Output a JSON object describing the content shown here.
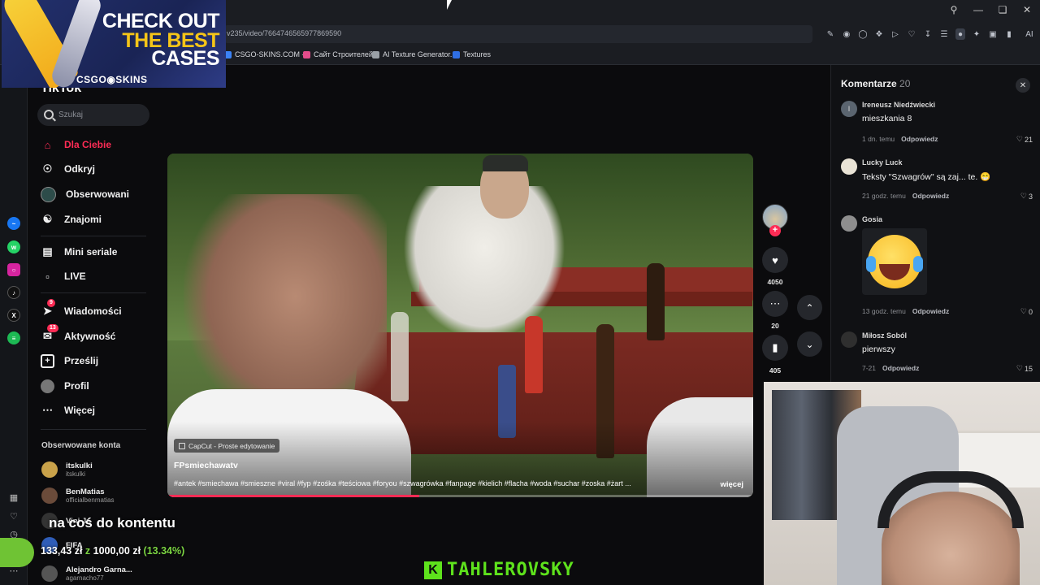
{
  "browser": {
    "url": "v235/video/7664746565977869590",
    "bookmarks": [
      {
        "label": "CSGO-SKINS.COM -...",
        "color": "#3b82f6"
      },
      {
        "label": "Сайт Строителей",
        "color": "#e24c8a"
      },
      {
        "label": "AI Texture Generator...",
        "color": "#9aa0a6"
      },
      {
        "label": "Textures",
        "color": "#2f6fe4"
      }
    ],
    "ai_button": "AI"
  },
  "ad": {
    "line1": "CHECK OUT",
    "line2": "THE BEST",
    "line3": "CASES",
    "logo": "CSGO◉SKINS"
  },
  "sidebar": {
    "logo": "TikTok",
    "search_placeholder": "Szukaj",
    "nav": [
      {
        "label": "Dla Ciebie",
        "icon": "home-icon",
        "active": true
      },
      {
        "label": "Odkryj",
        "icon": "compass-icon"
      },
      {
        "label": "Obserwowani",
        "icon": "following-avatar-icon"
      },
      {
        "label": "Znajomi",
        "icon": "friends-icon"
      },
      {
        "label": "Mini seriale",
        "icon": "series-icon"
      },
      {
        "label": "LIVE",
        "icon": "live-icon"
      },
      {
        "label": "Wiadomości",
        "icon": "messages-icon",
        "badge": "9"
      },
      {
        "label": "Aktywność",
        "icon": "activity-icon",
        "badge": "13"
      },
      {
        "label": "Prześlij",
        "icon": "upload-icon"
      },
      {
        "label": "Profil",
        "icon": "profile-icon"
      },
      {
        "label": "Więcej",
        "icon": "more-icon"
      }
    ],
    "followed_title": "Obserwowane konta",
    "accounts": [
      {
        "name": "itskulki",
        "handle": "itskulki",
        "color": "#c9a24a"
      },
      {
        "name": "BenMatias",
        "handle": "officialbenmatias",
        "color": "#6a4b3a"
      },
      {
        "name": "Vini Jr.",
        "handle": "",
        "color": "#333"
      },
      {
        "name": "FIFA",
        "handle": "",
        "color": "#2f5db8"
      },
      {
        "name": "Alejandro Garna...",
        "handle": "agarnacho77",
        "color": "#555"
      }
    ]
  },
  "video": {
    "capcut_label": "CapCut - Proste edytowanie",
    "author": "FPsmiechawatv",
    "tags": "#antek #smiechawa #smieszne #viral #fyp #zośka #teściowa #foryou #szwagrówka #fanpage #kielich #flacha #woda #suchar #zoska #żart ...",
    "more_label": "więcej",
    "progress": 0.43
  },
  "actions": {
    "likes": "4050",
    "comments": "20",
    "saves": "405"
  },
  "comments_panel": {
    "title": "Komentarze",
    "count": "20",
    "items": [
      {
        "name": "Ireneusz Niedźwiecki",
        "text": "mieszkania 8",
        "time": "1 dn. temu",
        "reply": "Odpowiedz",
        "likes": "21",
        "avatar_color": "#5b6570",
        "initial": "I"
      },
      {
        "name": "Lucky Luck",
        "text": "Teksty \"Szwagrów\" są zaj... te. 😁",
        "time": "21 godz. temu",
        "reply": "Odpowiedz",
        "likes": "3",
        "avatar_color": "#e9e3d6"
      },
      {
        "name": "Gosia",
        "text": "",
        "time": "13 godz. temu",
        "reply": "Odpowiedz",
        "likes": "0",
        "avatar_color": "#8e8e8e",
        "sticker": "laughing-crying-emoji"
      },
      {
        "name": "Miłosz Soból",
        "text": "pierwszy",
        "time": "7-21",
        "reply": "Odpowiedz",
        "likes": "15",
        "avatar_color": "#2f2f2f"
      }
    ]
  },
  "overlay": {
    "goal_text": "na coś do kontentu",
    "goal_current": "133,43 zł",
    "goal_of": "z",
    "goal_target": "1000,00 zł",
    "goal_percent": "(13.34%)",
    "goal_fraction": 0.1334,
    "brand_letter": "K",
    "brand_name": "TAHLEROVSKY"
  },
  "colors": {
    "accent": "#fe2c55",
    "brand_green": "#5ee21c"
  }
}
